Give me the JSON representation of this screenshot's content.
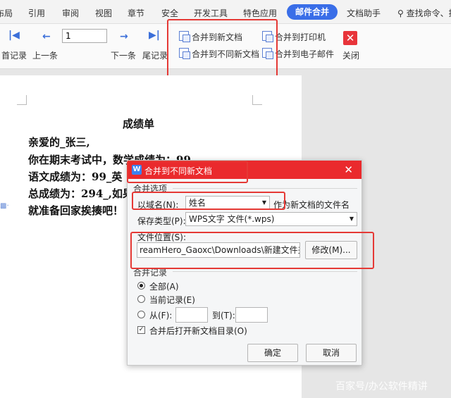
{
  "tabs": [
    {
      "label": "布局",
      "active": false
    },
    {
      "label": "引用",
      "active": false
    },
    {
      "label": "审阅",
      "active": false
    },
    {
      "label": "视图",
      "active": false
    },
    {
      "label": "章节",
      "active": false
    },
    {
      "label": "安全",
      "active": false
    },
    {
      "label": "开发工具",
      "active": false
    },
    {
      "label": "特色应用",
      "active": false
    },
    {
      "label": "邮件合并",
      "active": true
    },
    {
      "label": "文档助手",
      "active": false
    }
  ],
  "search": {
    "label": "查找命令、搜"
  },
  "ribbon": {
    "first_record": "首记录",
    "prev_record": "上一条",
    "record_value": "1",
    "next_record": "下一条",
    "last_record": "尾记录",
    "merge_new_doc": "合并到新文档",
    "merge_diff_docs": "合并到不同新文档",
    "merge_printer": "合并到打印机",
    "merge_email": "合并到电子邮件",
    "close": "关闭"
  },
  "document": {
    "title": "成绩单",
    "lines": [
      "亲爱的_张三,",
      "你在期末考试中，数学成绩为：99",
      "语文成绩为：99_英",
      "总成绩为：294_,如果",
      "就准备回家挨揍吧！"
    ]
  },
  "dialog": {
    "title": "合并到不同新文档",
    "merge_options": "合并选项",
    "domain_label": "以域名(N):",
    "domain_value": "姓名",
    "domain_suffix": "作为新文档的文件名",
    "save_type_label": "保存类型(P):",
    "save_type_value": "WPS文字 文件(*.wps)",
    "location_label": "文件位置(S):",
    "location_value": "reamHero_Gaoxc\\Downloads\\新建文件夹",
    "modify_button": "修改(M)...",
    "merge_records": "合并记录",
    "all_label": "全部(A)",
    "current_label": "当前记录(E)",
    "from_label": "从(F):",
    "to_label": "到(T):",
    "open_dir_label": "合并后打开新文档目录(O)",
    "ok_button": "确定",
    "cancel_button": "取消"
  },
  "watermark": "百家号/办公软件精讲",
  "colors": {
    "accent": "#3a6ee8",
    "dialog_title": "#ea2a2d",
    "highlight": "#e53935"
  }
}
